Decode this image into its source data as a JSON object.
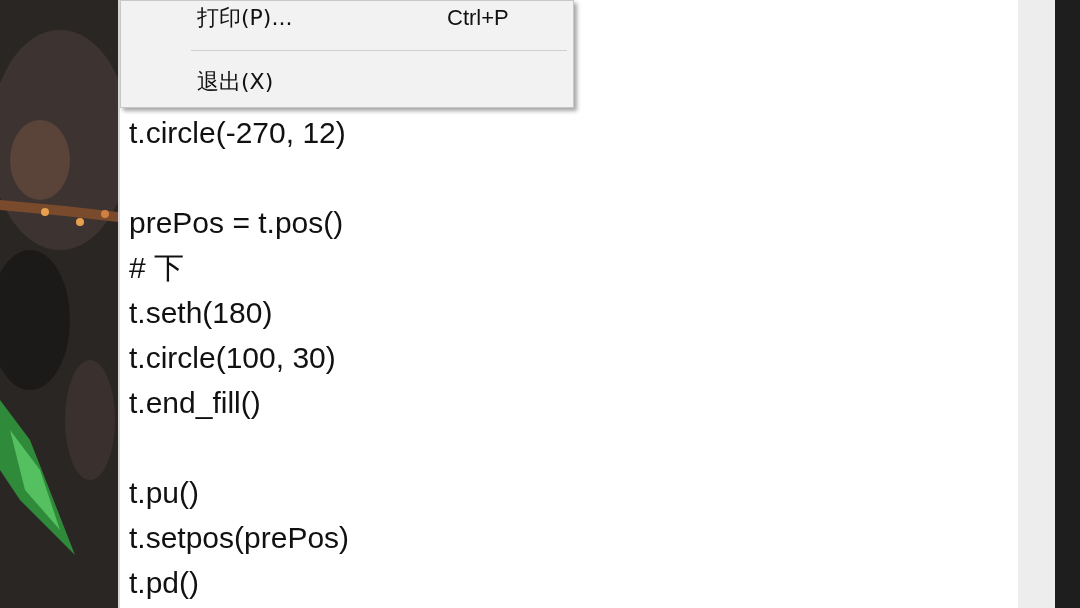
{
  "menu": {
    "items": [
      {
        "kind": "item",
        "label": "打印(P)...",
        "shortcut": "Ctrl+P"
      },
      {
        "kind": "separator"
      },
      {
        "kind": "item",
        "label": "退出(X)"
      }
    ]
  },
  "editor": {
    "lines": [
      {
        "kind": "code",
        "text": "t.circle(-270, 12)"
      },
      {
        "kind": "blank"
      },
      {
        "kind": "code",
        "text": "prePos = t.pos()"
      },
      {
        "kind": "code",
        "text": "# 下"
      },
      {
        "kind": "code",
        "text": "t.seth(180)"
      },
      {
        "kind": "code",
        "text": "t.circle(100, 30)"
      },
      {
        "kind": "code",
        "text": "t.end_fill()"
      },
      {
        "kind": "blank"
      },
      {
        "kind": "code",
        "text": "t.pu()"
      },
      {
        "kind": "code",
        "text": "t.setpos(prePos)"
      },
      {
        "kind": "code",
        "text": "t.pd()"
      }
    ]
  }
}
